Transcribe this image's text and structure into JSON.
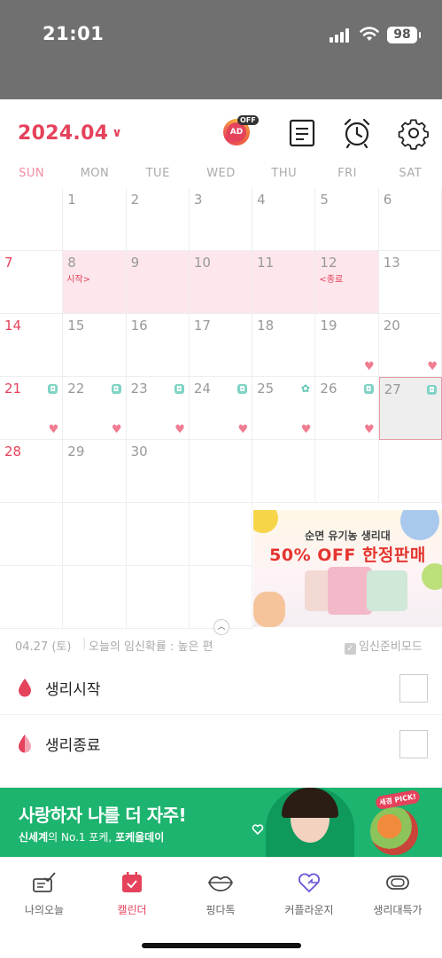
{
  "status_bar": {
    "time": "21:01",
    "battery": "98"
  },
  "header": {
    "month": "2024.04",
    "ad_badge": "AD",
    "ad_off": "OFF"
  },
  "weekdays": [
    "SUN",
    "MON",
    "TUE",
    "WED",
    "THU",
    "FRI",
    "SAT"
  ],
  "calendar": {
    "days": [
      {
        "n": "",
        "row": 0,
        "col": 0
      },
      {
        "n": "1",
        "row": 0,
        "col": 1
      },
      {
        "n": "2",
        "row": 0,
        "col": 2
      },
      {
        "n": "3",
        "row": 0,
        "col": 3
      },
      {
        "n": "4",
        "row": 0,
        "col": 4
      },
      {
        "n": "5",
        "row": 0,
        "col": 5
      },
      {
        "n": "6",
        "row": 0,
        "col": 6
      },
      {
        "n": "7",
        "row": 1,
        "col": 0,
        "red": true
      },
      {
        "n": "8",
        "row": 1,
        "col": 1,
        "period": true,
        "label": "시작>"
      },
      {
        "n": "9",
        "row": 1,
        "col": 2,
        "period": true
      },
      {
        "n": "10",
        "row": 1,
        "col": 3,
        "period": true
      },
      {
        "n": "11",
        "row": 1,
        "col": 4,
        "period": true
      },
      {
        "n": "12",
        "row": 1,
        "col": 5,
        "period": true,
        "label": "<종료"
      },
      {
        "n": "13",
        "row": 1,
        "col": 6
      },
      {
        "n": "14",
        "row": 2,
        "col": 0,
        "red": true
      },
      {
        "n": "15",
        "row": 2,
        "col": 1
      },
      {
        "n": "16",
        "row": 2,
        "col": 2
      },
      {
        "n": "17",
        "row": 2,
        "col": 3
      },
      {
        "n": "18",
        "row": 2,
        "col": 4
      },
      {
        "n": "19",
        "row": 2,
        "col": 5,
        "heart": true
      },
      {
        "n": "20",
        "row": 2,
        "col": 6,
        "heart": true
      },
      {
        "n": "21",
        "row": 3,
        "col": 0,
        "red": true,
        "dot": true,
        "heart": true
      },
      {
        "n": "22",
        "row": 3,
        "col": 1,
        "dot": true,
        "heart": true
      },
      {
        "n": "23",
        "row": 3,
        "col": 2,
        "dot": true,
        "heart": true
      },
      {
        "n": "24",
        "row": 3,
        "col": 3,
        "dot": true,
        "heart": true
      },
      {
        "n": "25",
        "row": 3,
        "col": 4,
        "flower": true,
        "heart": true
      },
      {
        "n": "26",
        "row": 3,
        "col": 5,
        "dot": true,
        "heart": true
      },
      {
        "n": "27",
        "row": 3,
        "col": 6,
        "dot": true,
        "today": true
      },
      {
        "n": "28",
        "row": 4,
        "col": 0,
        "red": true
      },
      {
        "n": "29",
        "row": 4,
        "col": 1
      },
      {
        "n": "30",
        "row": 4,
        "col": 2
      },
      {
        "n": "",
        "row": 4,
        "col": 3
      },
      {
        "n": "",
        "row": 4,
        "col": 4
      },
      {
        "n": "",
        "row": 4,
        "col": 5
      },
      {
        "n": "",
        "row": 4,
        "col": 6
      },
      {
        "n": "",
        "row": 5,
        "col": 0
      },
      {
        "n": "",
        "row": 5,
        "col": 1
      },
      {
        "n": "",
        "row": 5,
        "col": 2
      },
      {
        "n": "",
        "row": 5,
        "col": 3
      },
      {
        "n": "",
        "row": 6,
        "col": 0
      },
      {
        "n": "",
        "row": 6,
        "col": 1
      },
      {
        "n": "",
        "row": 6,
        "col": 2
      },
      {
        "n": "",
        "row": 6,
        "col": 3
      }
    ]
  },
  "calendar_ad": {
    "line1": "순면 유기농 생리대",
    "line2": "50% OFF 한정판매"
  },
  "info_bar": {
    "date": "04.27 (토)",
    "separator": "|",
    "pregnancy": "오늘의 임신확률 : 높은 편",
    "mode": "임신준비모드"
  },
  "checklist": [
    {
      "label": "생리시작",
      "icon": "blood-drop-icon"
    },
    {
      "label": "생리종료",
      "icon": "blood-drop-half-icon"
    }
  ],
  "banner": {
    "title": "사랑하자 나를 더 자주!",
    "brand": "신세계",
    "sub_mid": "의 No.1 포케, ",
    "product": "포케올데이",
    "pick": "세경 PICK!"
  },
  "tabs": [
    {
      "label": "나의오늘",
      "icon": "checklist-icon",
      "active": false
    },
    {
      "label": "캘린더",
      "icon": "calendar-icon",
      "active": true
    },
    {
      "label": "핑다톡",
      "icon": "lips-icon",
      "active": false
    },
    {
      "label": "커플라운지",
      "icon": "heart-chat-icon",
      "active": false
    },
    {
      "label": "생리대특가",
      "icon": "pad-icon",
      "active": false
    }
  ],
  "colors": {
    "accent": "#e5425c",
    "period": "#fde7ec",
    "fertile_dot": "#7fd3c4",
    "heart": "#f07d92",
    "banner": "#1db46f"
  }
}
